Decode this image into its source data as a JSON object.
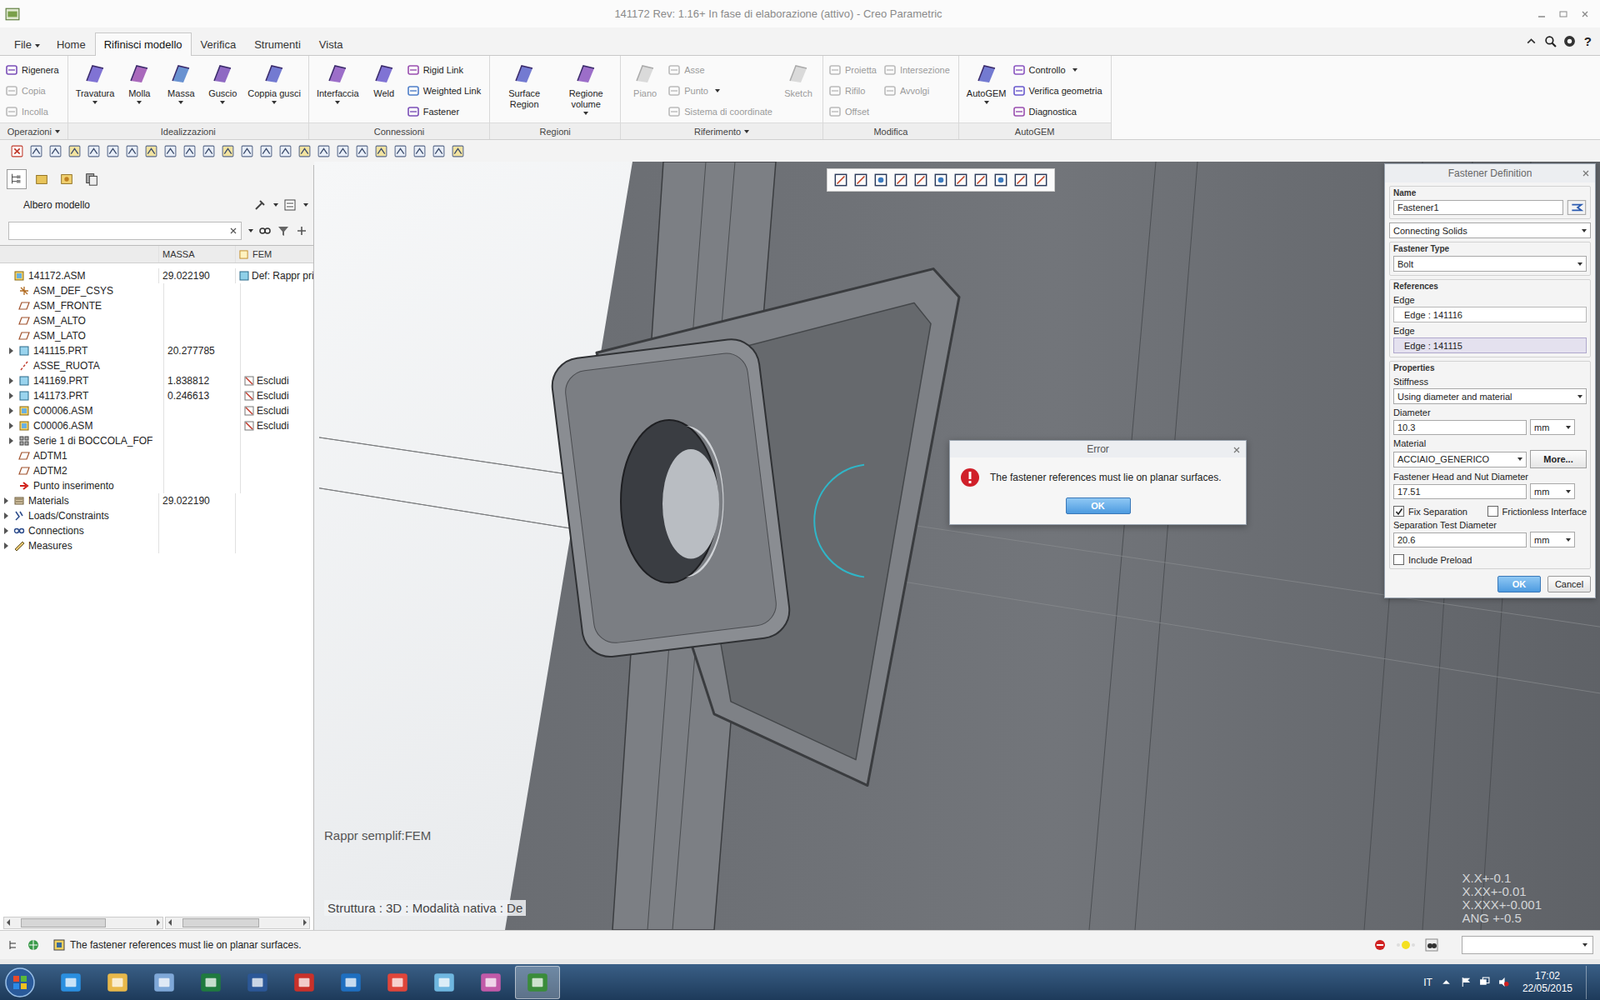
{
  "window": {
    "title": "141172 Rev: 1.16+ In fase di elaborazione  (attivo) - Creo Parametric"
  },
  "menu_tabs": [
    {
      "label": "File",
      "selected": false,
      "dropdown": true
    },
    {
      "label": "Home",
      "selected": false,
      "dropdown": false
    },
    {
      "label": "Rifinisci modello",
      "selected": true,
      "dropdown": false
    },
    {
      "label": "Verifica",
      "selected": false,
      "dropdown": false
    },
    {
      "label": "Strumenti",
      "selected": false,
      "dropdown": false
    },
    {
      "label": "Vista",
      "selected": false,
      "dropdown": false
    }
  ],
  "help": "?",
  "ribbon": {
    "groups": [
      {
        "label": "Operazioni",
        "dropdown": true,
        "buttons": [
          {
            "label": "Rigenera",
            "kind": "small",
            "disabled": false,
            "dropdown": false
          },
          {
            "label": "Copia",
            "kind": "small",
            "disabled": true,
            "dropdown": false
          },
          {
            "label": "Incolla",
            "kind": "small",
            "disabled": true,
            "dropdown": false
          }
        ]
      },
      {
        "label": "Idealizzazioni",
        "dropdown": false,
        "buttons": [
          {
            "label": "Travatura",
            "kind": "large",
            "disabled": false,
            "dropdown": true
          },
          {
            "label": "Molla",
            "kind": "large",
            "disabled": false,
            "dropdown": true
          },
          {
            "label": "Massa",
            "kind": "large",
            "disabled": false,
            "dropdown": true
          },
          {
            "label": "Guscio",
            "kind": "large",
            "disabled": false,
            "dropdown": true
          },
          {
            "label": "Coppia gusci",
            "kind": "large",
            "disabled": false,
            "dropdown": true
          }
        ]
      },
      {
        "label": "Connessioni",
        "dropdown": false,
        "buttons": [
          {
            "label": "Interfaccia",
            "kind": "large",
            "disabled": false,
            "dropdown": true
          },
          {
            "label": "Weld",
            "kind": "large",
            "disabled": false,
            "dropdown": false
          },
          {
            "label": "Rigid Link",
            "kind": "small",
            "disabled": false,
            "dropdown": false
          },
          {
            "label": "Weighted Link",
            "kind": "small",
            "disabled": false,
            "dropdown": false
          },
          {
            "label": "Fastener",
            "kind": "small",
            "disabled": false,
            "dropdown": false
          }
        ]
      },
      {
        "label": "Regioni",
        "dropdown": false,
        "buttons": [
          {
            "label": "Surface Region",
            "kind": "large",
            "disabled": false,
            "dropdown": false
          },
          {
            "label": "Regione volume",
            "kind": "large",
            "disabled": false,
            "dropdown": true
          }
        ]
      },
      {
        "label": "Riferimento",
        "dropdown": true,
        "buttons": [
          {
            "label": "Piano",
            "kind": "large",
            "disabled": true,
            "dropdown": false
          },
          {
            "label": "Asse",
            "kind": "small",
            "disabled": true,
            "dropdown": false
          },
          {
            "label": "Punto",
            "kind": "small",
            "disabled": true,
            "dropdown": true
          },
          {
            "label": "Sistema di coordinate",
            "kind": "small",
            "disabled": true,
            "dropdown": false
          },
          {
            "label": "Sketch",
            "kind": "large",
            "disabled": true,
            "dropdown": false
          }
        ]
      },
      {
        "label": "Modifica",
        "dropdown": false,
        "buttons": [
          {
            "label": "Proietta",
            "kind": "small",
            "disabled": true,
            "dropdown": false
          },
          {
            "label": "Rifilo",
            "kind": "small",
            "disabled": true,
            "dropdown": false
          },
          {
            "label": "Offset",
            "kind": "small",
            "disabled": true,
            "dropdown": false
          },
          {
            "label": "Intersezione",
            "kind": "small",
            "disabled": true,
            "dropdown": false
          },
          {
            "label": "Avvolgi",
            "kind": "small",
            "disabled": true,
            "dropdown": false
          }
        ]
      },
      {
        "label": "AutoGEM",
        "dropdown": false,
        "buttons": [
          {
            "label": "AutoGEM",
            "kind": "large",
            "disabled": false,
            "dropdown": true
          },
          {
            "label": "Controllo",
            "kind": "small",
            "disabled": false,
            "dropdown": true
          },
          {
            "label": "Verifica geometria",
            "kind": "small",
            "disabled": false,
            "dropdown": false
          },
          {
            "label": "Diagnostica",
            "kind": "small",
            "disabled": false,
            "dropdown": false
          }
        ]
      }
    ]
  },
  "model_tree": {
    "title": "Albero modello",
    "search": "",
    "columns": [
      "MASSA",
      "FEM"
    ],
    "rows": [
      {
        "name": "141172.ASM",
        "kind": "asm",
        "mass": "29.022190",
        "fem": "Def: Rappr pri",
        "expandable": false,
        "child": false
      },
      {
        "name": "ASM_DEF_CSYS",
        "kind": "csys",
        "mass": "",
        "fem": "",
        "expandable": false,
        "child": true
      },
      {
        "name": "ASM_FRONTE",
        "kind": "plane",
        "mass": "",
        "fem": "",
        "expandable": false,
        "child": true
      },
      {
        "name": "ASM_ALTO",
        "kind": "plane",
        "mass": "",
        "fem": "",
        "expandable": false,
        "child": true
      },
      {
        "name": "ASM_LATO",
        "kind": "plane",
        "mass": "",
        "fem": "",
        "expandable": false,
        "child": true
      },
      {
        "name": "141115.PRT",
        "kind": "prt",
        "mass": "20.277785",
        "fem": "",
        "expandable": true,
        "child": true
      },
      {
        "name": "ASSE_RUOTA",
        "kind": "axis",
        "mass": "",
        "fem": "",
        "expandable": false,
        "child": true
      },
      {
        "name": "141169.PRT",
        "kind": "prt",
        "mass": "1.838812",
        "fem": "Escludi",
        "expandable": true,
        "child": true
      },
      {
        "name": "141173.PRT",
        "kind": "prt",
        "mass": "0.246613",
        "fem": "Escludi",
        "expandable": true,
        "child": true
      },
      {
        "name": "C00006.ASM",
        "kind": "asm",
        "mass": "",
        "fem": "Escludi",
        "expandable": true,
        "child": true
      },
      {
        "name": "C00006.ASM",
        "kind": "asm",
        "mass": "",
        "fem": "Escludi",
        "expandable": true,
        "child": true
      },
      {
        "name": "Serie 1 di BOCCOLA_FOF",
        "kind": "pattern",
        "mass": "",
        "fem": "",
        "expandable": true,
        "child": true
      },
      {
        "name": "ADTM1",
        "kind": "plane",
        "mass": "",
        "fem": "",
        "expandable": false,
        "child": true
      },
      {
        "name": "ADTM2",
        "kind": "plane",
        "mass": "",
        "fem": "",
        "expandable": false,
        "child": true
      },
      {
        "name": "Punto inserimento",
        "kind": "point",
        "mass": "",
        "fem": "",
        "expandable": false,
        "child": true
      },
      {
        "name": "Materials",
        "kind": "materials",
        "mass": "29.022190",
        "fem": "",
        "expandable": true,
        "child": false
      },
      {
        "name": "Loads/Constraints",
        "kind": "loads",
        "mass": "",
        "fem": "",
        "expandable": true,
        "child": false
      },
      {
        "name": "Connections",
        "kind": "connections",
        "mass": "",
        "fem": "",
        "expandable": true,
        "child": false
      },
      {
        "name": "Measures",
        "kind": "measures",
        "mass": "",
        "fem": "",
        "expandable": true,
        "child": false
      }
    ]
  },
  "viewport": {
    "representation": "Rappr semplif:FEM",
    "structure": "Struttura : 3D : Modalità nativa : De",
    "tolerances": [
      "X.X+-0.1",
      "X.XX+-0.01",
      "X.XXX+-0.001",
      "ANG +-0.5"
    ]
  },
  "fastener_dialog": {
    "title": "Fastener Definition",
    "name_label": "Name",
    "name": "Fastener1",
    "connection": "Connecting Solids",
    "type_label": "Fastener Type",
    "type": "Bolt",
    "references_label": "References",
    "references": [
      {
        "label": "Edge",
        "value": "Edge : 141116",
        "selected": false
      },
      {
        "label": "Edge",
        "value": "Edge : 141115",
        "selected": true
      }
    ],
    "properties_label": "Properties",
    "stiffness_label": "Stiffness",
    "stiffness": "Using diameter and material",
    "diameter_label": "Diameter",
    "diameter": "10.3",
    "diameter_unit": "mm",
    "material_label": "Material",
    "material": "ACCIAIO_GENERICO",
    "more_button": "More...",
    "head_label": "Fastener Head and Nut Diameter",
    "head": "17.51",
    "head_unit": "mm",
    "checkboxes": [
      {
        "label": "Fix Separation",
        "checked": true
      },
      {
        "label": "Frictionless Interface",
        "checked": false
      }
    ],
    "separation_label": "Separation Test Diameter",
    "separation": "20.6",
    "separation_unit": "mm",
    "preload": {
      "label": "Include Preload",
      "checked": false
    },
    "buttons": [
      {
        "label": "OK",
        "primary": true
      },
      {
        "label": "Cancel",
        "primary": false
      }
    ]
  },
  "error_dialog": {
    "title": "Error",
    "message": "The fastener references must lie on planar surfaces.",
    "button": "OK"
  },
  "status_bar": {
    "message": "The fastener references must lie on planar surfaces."
  },
  "taskbar": {
    "apps": [
      {
        "kind": "ie",
        "selected": false
      },
      {
        "kind": "explorer",
        "selected": false
      },
      {
        "kind": "paint",
        "selected": false
      },
      {
        "kind": "excel",
        "selected": false
      },
      {
        "kind": "word",
        "selected": false
      },
      {
        "kind": "acrobat",
        "selected": false
      },
      {
        "kind": "outlook",
        "selected": false
      },
      {
        "kind": "chrome",
        "selected": false
      },
      {
        "kind": "notes",
        "selected": false
      },
      {
        "kind": "viewer",
        "selected": false
      },
      {
        "kind": "creo",
        "selected": true
      }
    ],
    "language": "IT",
    "time": "17:02",
    "date": "22/05/2015"
  }
}
